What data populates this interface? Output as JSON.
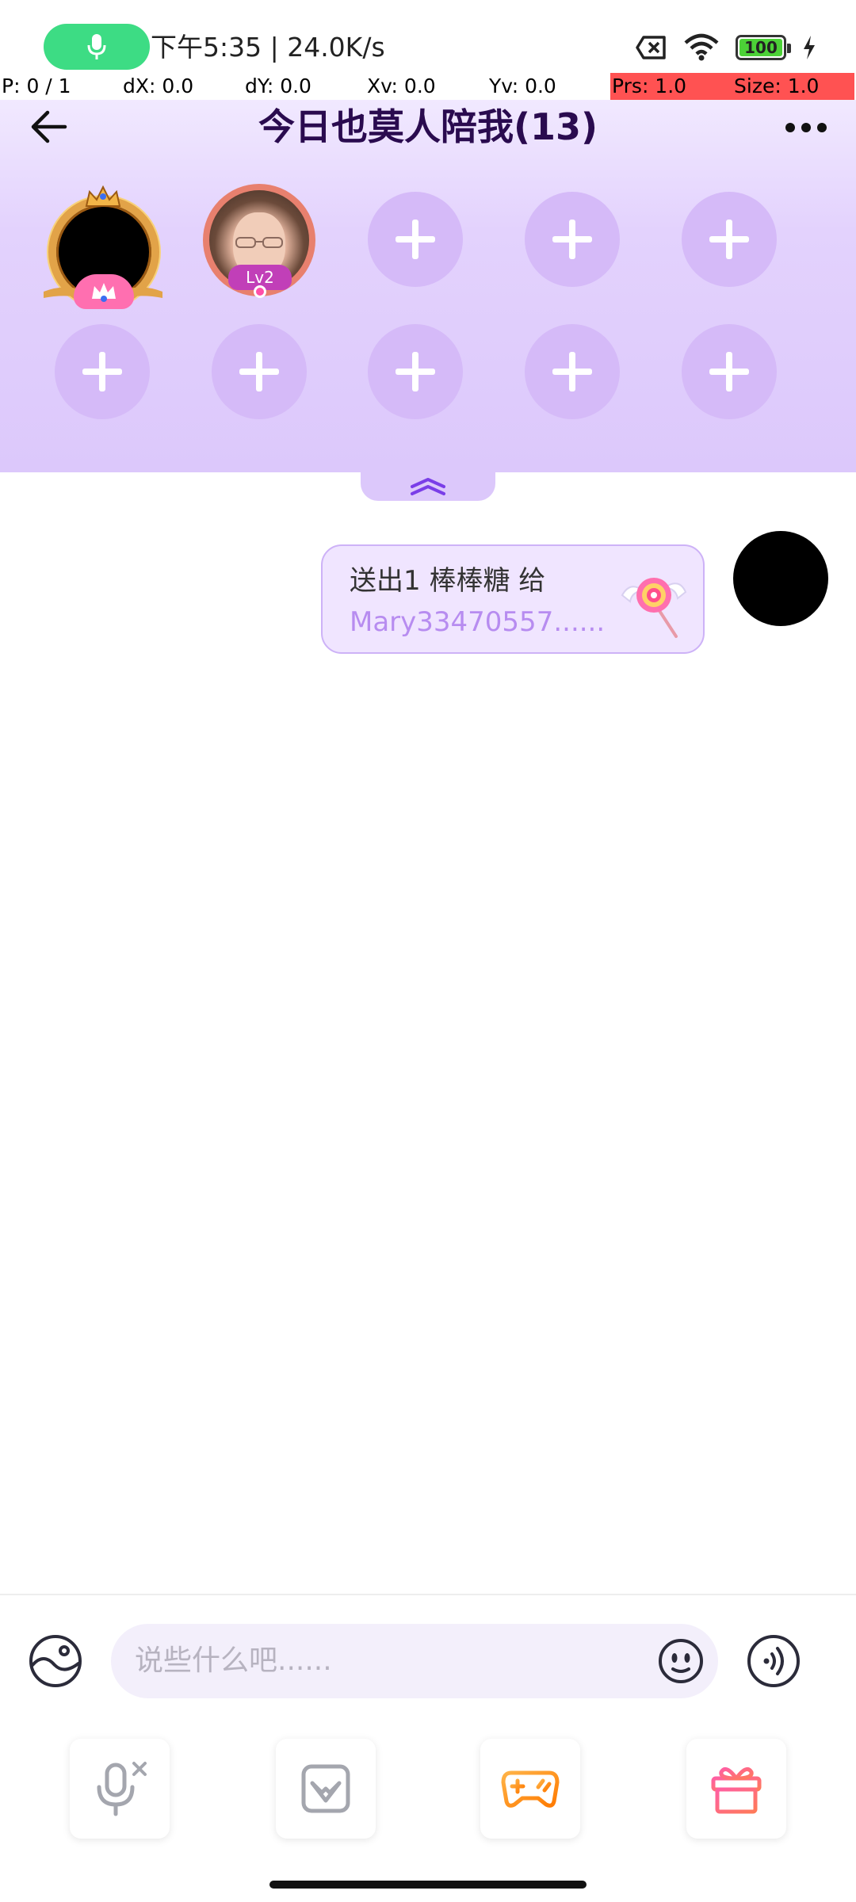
{
  "status_bar": {
    "time_and_speed": "下午5:35 | 24.0K/s",
    "battery_level": "100",
    "icons": [
      "mic-icon",
      "sim-off-icon",
      "wifi-icon",
      "battery-icon",
      "charging-icon"
    ]
  },
  "debug": {
    "pointer": "P: 0 / 1",
    "dx": "dX: 0.0",
    "dy": "dY: 0.0",
    "xv": "Xv: 0.0",
    "yv": "Yv: 0.0",
    "prs": "Prs: 1.0",
    "size": "Size: 1.0"
  },
  "room": {
    "title": "今日也莫人陪我(13)",
    "user_level": "Lv2",
    "empty_seat_count": 8,
    "icons": [
      "back-arrow-icon",
      "more-icon",
      "collapse-icon"
    ]
  },
  "message": {
    "line1": "送出1 棒棒糖 给",
    "line2": "Mary33470557......",
    "gift_icon": "lollipop-icon"
  },
  "input": {
    "placeholder": "说些什么吧......"
  },
  "toolbar": {
    "icons": [
      "mic-muted-icon",
      "photo-frame-icon",
      "gamepad-icon",
      "gift-icon"
    ]
  },
  "colors": {
    "accent": "#b78cf0",
    "header_bg": "#e3d2fd",
    "seat_bg": "#d5baf8",
    "title": "#2a0b4f",
    "mic_pill": "#3ddc84",
    "debug_red": "#ff5252"
  }
}
